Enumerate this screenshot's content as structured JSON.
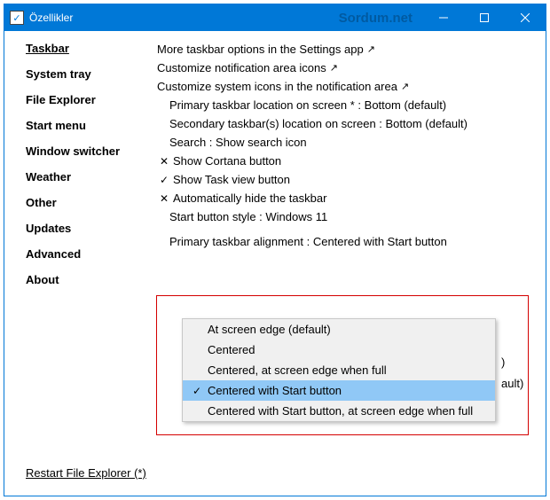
{
  "titlebar": {
    "title": "Özellikler",
    "watermark": "Sordum.net"
  },
  "sidebar": {
    "items": [
      {
        "label": "Taskbar",
        "active": true
      },
      {
        "label": "System tray",
        "active": false
      },
      {
        "label": "File Explorer",
        "active": false
      },
      {
        "label": "Start menu",
        "active": false
      },
      {
        "label": "Window switcher",
        "active": false
      },
      {
        "label": "Weather",
        "active": false
      },
      {
        "label": "Other",
        "active": false
      },
      {
        "label": "Updates",
        "active": false
      },
      {
        "label": "Advanced",
        "active": false
      },
      {
        "label": "About",
        "active": false
      }
    ]
  },
  "main": {
    "link0": "More taskbar options in the Settings app",
    "link1": "Customize notification area icons",
    "link2": "Customize system icons in the notification area",
    "rowA": "Primary taskbar location on screen * : Bottom (default)",
    "rowB": "Secondary taskbar(s) location on screen : Bottom (default)",
    "rowC": "Search : Show search icon",
    "rowD": "Show Cortana button",
    "rowE": "Show Task view button",
    "rowF": "Automatically hide the taskbar",
    "rowG": "Start button style : Windows 11",
    "dropdownLabel": "Primary taskbar alignment : Centered with Start button",
    "peek1": ")",
    "peek2": "ault)"
  },
  "dropdown": {
    "items": [
      {
        "label": "At screen edge (default)",
        "selected": false
      },
      {
        "label": "Centered",
        "selected": false
      },
      {
        "label": "Centered, at screen edge when full",
        "selected": false
      },
      {
        "label": "Centered with Start button",
        "selected": true
      },
      {
        "label": "Centered with Start button, at screen edge when full",
        "selected": false
      }
    ]
  },
  "footer": {
    "restart": "Restart File Explorer (*)"
  }
}
